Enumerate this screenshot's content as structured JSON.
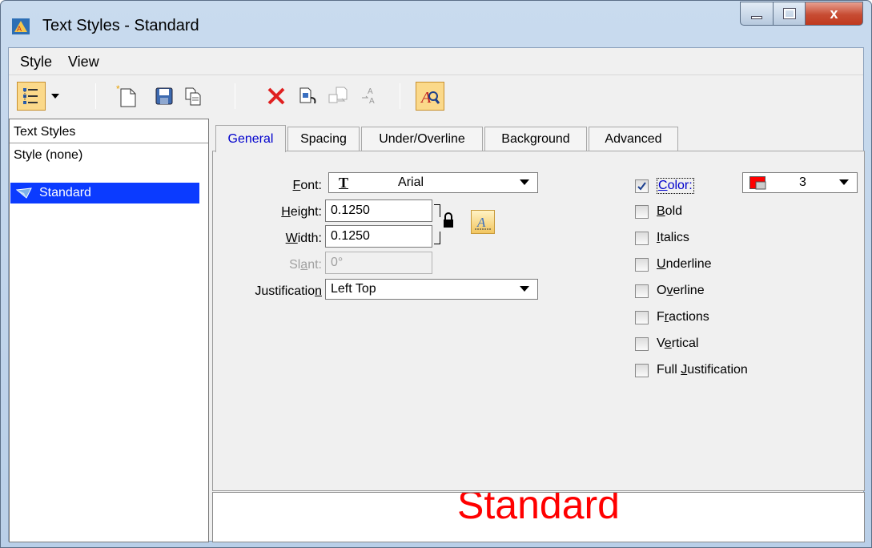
{
  "window": {
    "title": "Text Styles - Standard",
    "close_glyph": "x"
  },
  "menu": [
    {
      "label": "Style"
    },
    {
      "label": "View"
    }
  ],
  "toolbar": {
    "icons": [
      "list-view-icon",
      "dropdown-arrow-icon",
      "new-style-icon",
      "save-icon",
      "copy-icon",
      "delete-icon",
      "import-icon",
      "export-icon",
      "update-icon",
      "preview-toggle-icon"
    ]
  },
  "left_pane": {
    "header": "Text Styles",
    "none_item": "Style (none)",
    "selected_item": "Standard"
  },
  "tabs": [
    {
      "label": "General"
    },
    {
      "label": "Spacing"
    },
    {
      "label": "Under/Overline"
    },
    {
      "label": "Background"
    },
    {
      "label": "Advanced"
    }
  ],
  "general": {
    "font_label": "Font:",
    "font_value": "Arial",
    "font_type_glyph": "T",
    "height_label": "Height:",
    "height_value": "0.1250",
    "width_label": "Width:",
    "width_value": "0.1250",
    "slant_label": "Slant:",
    "slant_value": "0°",
    "justification_label": "Justification",
    "justification_value": "Left Top",
    "color_label": "Color:",
    "color_value": "3",
    "color_swatch": "#ff0000",
    "checkboxes": [
      {
        "label": "Color:",
        "checked": true
      },
      {
        "label": "Bold",
        "checked": false
      },
      {
        "label": "Italics",
        "checked": false
      },
      {
        "label": "Underline",
        "checked": false
      },
      {
        "label": "Overline",
        "checked": false
      },
      {
        "label": "Fractions",
        "checked": false
      },
      {
        "label": "Vertical",
        "checked": false
      },
      {
        "label": "Full Justification",
        "checked": false
      }
    ]
  },
  "preview": {
    "text": "Standard",
    "color": "#ff0000"
  }
}
